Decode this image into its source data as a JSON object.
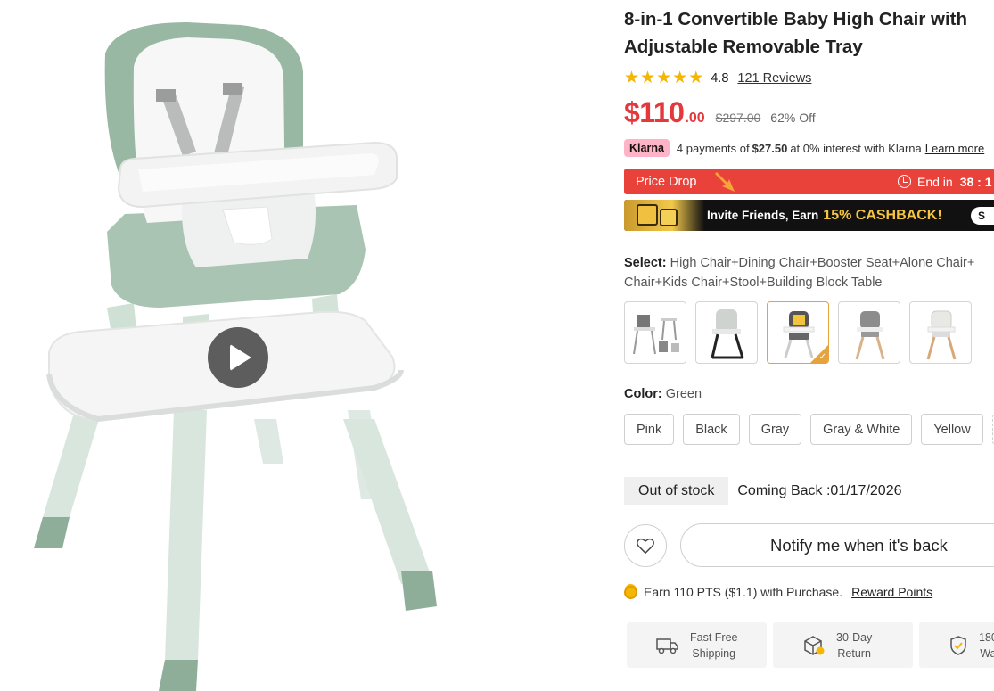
{
  "product": {
    "title": "8-in-1 Convertible Baby High Chair with Adjustable Removable Tray",
    "rating": "4.8",
    "stars": 5,
    "reviews_label": "121 Reviews"
  },
  "price": {
    "current_main": "$110",
    "current_cents": ".00",
    "original": "$297.00",
    "discount": "62% Off",
    "accent_color": "#e4393c"
  },
  "klarna": {
    "badge": "Klarna",
    "text_before": "4 payments of",
    "amount": "$27.50",
    "text_after": "at 0% interest with Klarna",
    "learn_more": "Learn more"
  },
  "price_drop": {
    "label": "Price Drop",
    "end_label": "End in",
    "time": "38 : 1",
    "color": "#e9423a"
  },
  "invite_banner": {
    "text": "Invite Friends, Earn",
    "highlight": "15% CASHBACK!",
    "button": "S"
  },
  "select": {
    "label": "Select:",
    "value": "High Chair+Dining Chair+Booster Seat+Alone Chair+ Chair+Kids Chair+Stool+Building Block Table",
    "thumbnails": [
      {
        "icon": "high-chair-set-thumb",
        "selected": false
      },
      {
        "icon": "foldable-high-chair-thumb",
        "selected": false
      },
      {
        "icon": "yellow-high-chair-thumb",
        "selected": true
      },
      {
        "icon": "wooden-high-chair-gray-thumb",
        "selected": false
      },
      {
        "icon": "wooden-high-chair-white-thumb",
        "selected": false
      }
    ]
  },
  "color": {
    "label": "Color:",
    "value": "Green",
    "options": [
      "Pink",
      "Black",
      "Gray",
      "Gray & White",
      "Yellow"
    ]
  },
  "stock": {
    "status": "Out of stock",
    "coming_back": "Coming Back :01/17/2026"
  },
  "actions": {
    "notify_label": "Notify me when it's back",
    "wishlist_icon": "heart-icon"
  },
  "points": {
    "text": "Earn 110 PTS ($1.1) with Purchase.",
    "link": "Reward Points"
  },
  "perks": [
    {
      "icon": "truck-icon",
      "label": "Fast Free\nShipping"
    },
    {
      "icon": "return-box-icon",
      "label": "30-Day\nReturn"
    },
    {
      "icon": "shield-check-icon",
      "label": "180\nWa"
    }
  ],
  "media": {
    "play_icon": "play-icon",
    "product_color": "#9ab8a4"
  }
}
